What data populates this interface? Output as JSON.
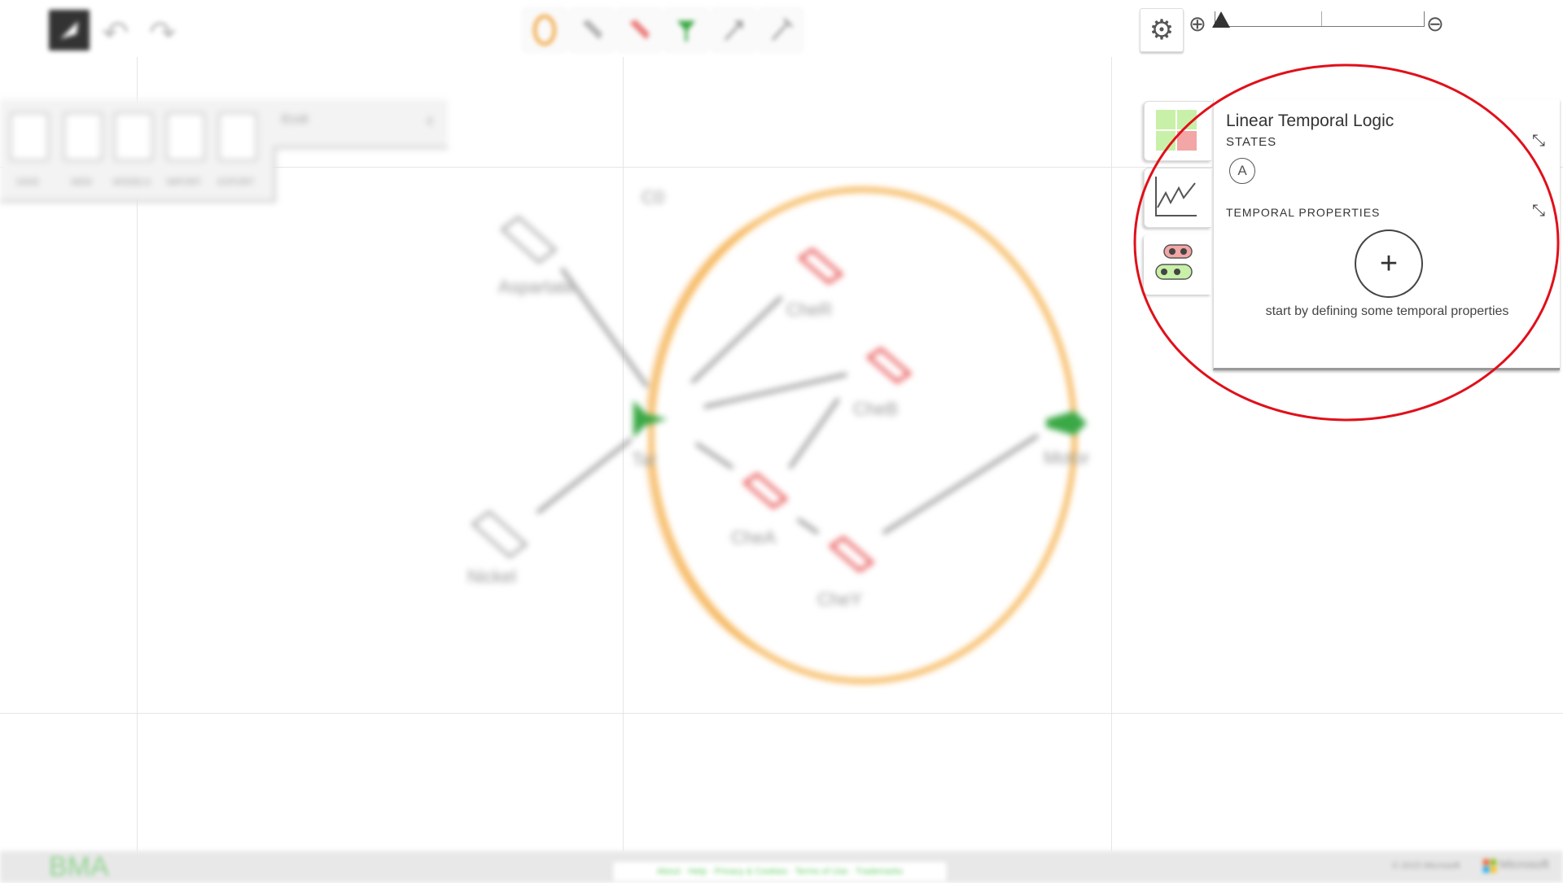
{
  "toolbar": {
    "logo_icon": "bma-logo-icon",
    "undo_icon": "undo-icon",
    "redo_icon": "redo-icon",
    "tools": [
      {
        "name": "container-tool",
        "icon": "cell-icon",
        "color": "#f2a33a"
      },
      {
        "name": "variable-tool",
        "icon": "variable-icon",
        "color": "#999999"
      },
      {
        "name": "constant-tool",
        "icon": "constant-icon",
        "color": "#e84c4c"
      },
      {
        "name": "receptor-tool",
        "icon": "receptor-icon",
        "color": "#3aa845"
      },
      {
        "name": "activator-tool",
        "icon": "activator-icon",
        "color": "#999999"
      },
      {
        "name": "inhibitor-tool",
        "icon": "inhibitor-icon",
        "color": "#999999"
      }
    ]
  },
  "file_panel": {
    "title": "Ecoli",
    "buttons": [
      {
        "label": "SAVE",
        "icon": "save-icon"
      },
      {
        "label": "NEW",
        "icon": "new-file-icon"
      },
      {
        "label": "MODELS",
        "icon": "models-icon"
      },
      {
        "label": "IMPORT",
        "icon": "import-icon"
      },
      {
        "label": "EXPORT",
        "icon": "export-icon"
      }
    ]
  },
  "canvas": {
    "cell_label": "C0",
    "colors": {
      "cell": "#f2a33a",
      "constant": "#e84c4c",
      "receptor": "#3aa845",
      "link": "#888888"
    },
    "nodes": [
      {
        "label": "Aspartate",
        "kind": "variable"
      },
      {
        "label": "Nickel",
        "kind": "variable"
      },
      {
        "label": "Tar",
        "kind": "receptor"
      },
      {
        "label": "Motor",
        "kind": "receptor"
      },
      {
        "label": "CheR",
        "kind": "constant"
      },
      {
        "label": "CheB",
        "kind": "constant"
      },
      {
        "label": "CheA",
        "kind": "constant"
      },
      {
        "label": "CheY",
        "kind": "constant"
      }
    ]
  },
  "controls": {
    "settings_icon": "gear-icon",
    "zoom_in_icon": "zoom-in-icon",
    "zoom_out_icon": "zoom-out-icon",
    "zoom_level": 0
  },
  "side_tabs": [
    {
      "name": "proof-tab",
      "icon": "proof-grid-icon"
    },
    {
      "name": "simulation-tab",
      "icon": "simulation-graph-icon"
    },
    {
      "name": "ltl-tab",
      "icon": "ltl-states-icon"
    }
  ],
  "ltl_panel": {
    "title": "Linear Temporal Logic",
    "states_heading": "STATES",
    "state_badge": "A",
    "temporal_heading": "TEMPORAL PROPERTIES",
    "add_symbol": "+",
    "hint": "start by defining some temporal properties"
  },
  "annotation": {
    "color": "#e0101a",
    "shape": "ellipse"
  },
  "footer": {
    "logo": "BMA",
    "links": "About · Help · Privacy & Cookies · Terms of Use · Trademarks",
    "copyright": "© 2015 Microsoft",
    "brand": "Microsoft"
  }
}
